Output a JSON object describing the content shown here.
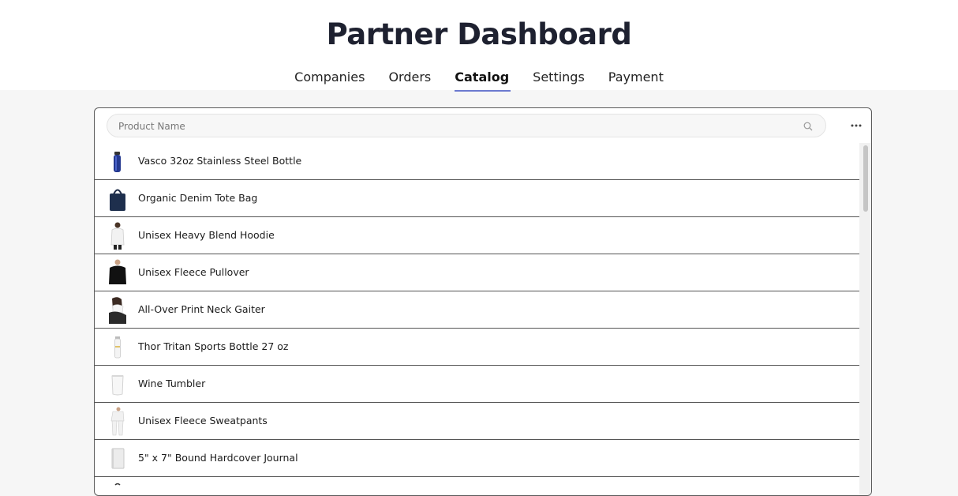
{
  "header": {
    "title": "Partner Dashboard",
    "tabs": [
      {
        "label": "Companies",
        "active": false
      },
      {
        "label": "Orders",
        "active": false
      },
      {
        "label": "Catalog",
        "active": true
      },
      {
        "label": "Settings",
        "active": false
      },
      {
        "label": "Payment",
        "active": false
      }
    ]
  },
  "catalog": {
    "search_placeholder": "Product Name",
    "search_value": "",
    "more_icon": "more-horizontal-icon",
    "products": [
      {
        "name": "Vasco 32oz Stainless Steel Bottle",
        "thumb": "blue-bottle"
      },
      {
        "name": "Organic Denim Tote Bag",
        "thumb": "navy-tote"
      },
      {
        "name": "Unisex Heavy Blend Hoodie",
        "thumb": "white-hoodie"
      },
      {
        "name": "Unisex Fleece Pullover",
        "thumb": "black-pullover"
      },
      {
        "name": "All-Over Print Neck Gaiter",
        "thumb": "neck-gaiter"
      },
      {
        "name": "Thor Tritan Sports Bottle 27 oz",
        "thumb": "clear-bottle"
      },
      {
        "name": "Wine Tumbler",
        "thumb": "white-tumbler"
      },
      {
        "name": "Unisex Fleece Sweatpants",
        "thumb": "white-sweatpants"
      },
      {
        "name": "5\" x 7\" Bound Hardcover Journal",
        "thumb": "white-journal"
      },
      {
        "name": "",
        "thumb": "partial-item"
      }
    ]
  },
  "colors": {
    "accent_underline": "#6c7ad0",
    "page_background": "#f6f6f6",
    "title_color": "#1e2130"
  }
}
